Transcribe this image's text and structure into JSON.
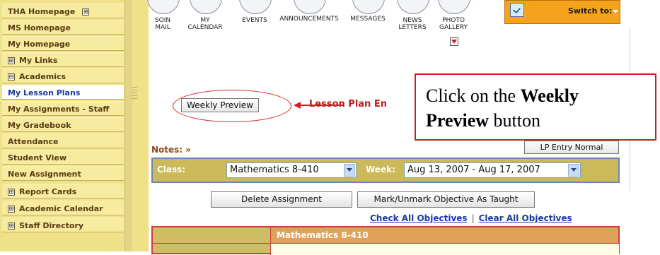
{
  "sidebar": {
    "items": [
      {
        "label": "THA Homepage",
        "icon": "plus-box-icon",
        "icon_side": "right"
      },
      {
        "label": "MS Homepage"
      },
      {
        "label": "My Homepage"
      },
      {
        "label": "My Links",
        "icon": "plus-box-icon"
      },
      {
        "label": "Academics",
        "icon": "minus-box-icon"
      },
      {
        "label": "My Lesson Plans",
        "active": true
      },
      {
        "label": "My Assignments - Staff"
      },
      {
        "label": "My Gradebook"
      },
      {
        "label": "Attendance"
      },
      {
        "label": "Student View"
      },
      {
        "label": "New Assignment"
      },
      {
        "label": "Report Cards",
        "icon": "plus-box-icon"
      },
      {
        "label": "Academic Calendar",
        "icon": "plus-box-icon"
      },
      {
        "label": "Staff Directory",
        "icon": "plus-box-icon"
      }
    ],
    "glyphs": {
      "plus": "⊞",
      "minus": "⊟"
    }
  },
  "toolbar": {
    "soin_mail": [
      "SOIN",
      "MAIL"
    ],
    "my_calendar": [
      "MY",
      "CALENDAR"
    ],
    "events": "EVENTS",
    "announcements": "ANNOUNCEMENTS",
    "messages": "MESSAGES",
    "newsletters": [
      "NEWS",
      "LETTERS"
    ],
    "photo_gallery": [
      "PHOTO",
      "GALLERY"
    ]
  },
  "switch_to": {
    "label": "Switch to:",
    "color": "#f5a21e"
  },
  "weekly_preview": {
    "label": "Weekly Preview"
  },
  "lesson_plan_heading": "Lesson Plan En",
  "callout": {
    "line1_prefix": "Click on the ",
    "line1_bold": "Weekly",
    "line2_bold": "Preview",
    "line2_suffix": " button",
    "border_color": "#c82020"
  },
  "notes": {
    "label": "Notes: »"
  },
  "lp_entry_button": {
    "label": "LP Entry Normal"
  },
  "class_bar": {
    "class_label": "Class:",
    "class_value": "Mathematics 8-410",
    "week_label": "Week:",
    "week_value": "Aug 13, 2007 - Aug 17, 2007"
  },
  "actions": {
    "delete_assignment": "Delete Assignment",
    "mark_objective": "Mark/Unmark Objective As Taught"
  },
  "objective_links": {
    "check_all": "Check All Objectives",
    "separator": "|",
    "clear_all": "Clear All Objectives"
  },
  "table": {
    "header": "Mathematics 8-410"
  },
  "colors": {
    "sidebar_bg": "#efe08a",
    "active_item_text": "#1b3a9a",
    "accent_red": "#c01a1a",
    "link_blue": "#1a3aa8"
  }
}
